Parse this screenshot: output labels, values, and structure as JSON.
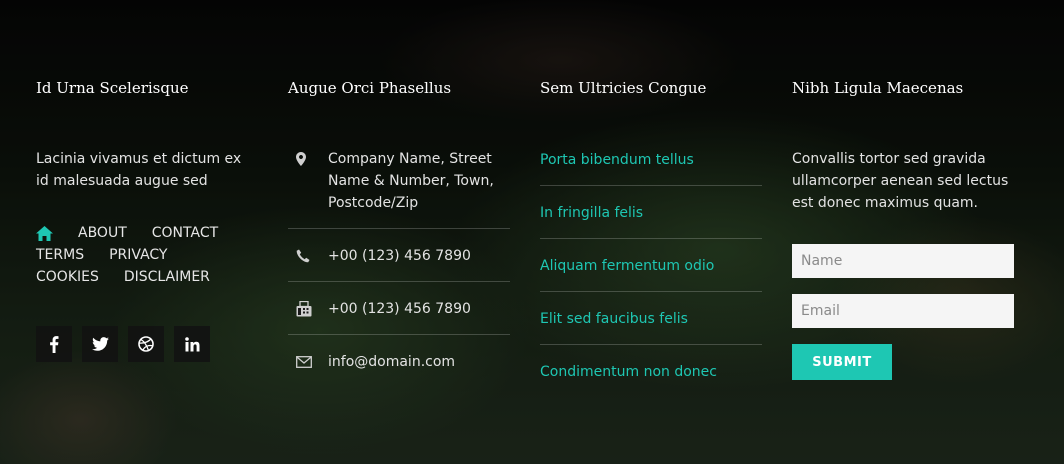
{
  "colors": {
    "accent": "#1ec7b3",
    "background": "#0b0f0b",
    "text": "#e6e6e6"
  },
  "col1": {
    "title": "Id Urna Scelerisque",
    "text": "Lacinia vivamus et dictum ex id malesuada augue sed",
    "nav": [
      "ABOUT",
      "CONTACT",
      "TERMS",
      "PRIVACY",
      "COOKIES",
      "DISCLAIMER"
    ],
    "social_icons": [
      "facebook-icon",
      "twitter-icon",
      "dribbble-icon",
      "linkedin-icon"
    ]
  },
  "col2": {
    "title": "Augue Orci Phasellus",
    "address": "Company Name, Street Name & Number, Town, Postcode/Zip",
    "phone": "+00 (123) 456 7890",
    "fax": "+00 (123) 456 7890",
    "email": "info@domain.com"
  },
  "col3": {
    "title": "Sem Ultricies Congue",
    "links": [
      "Porta bibendum tellus",
      "In fringilla felis",
      "Aliquam fermentum odio",
      "Elit sed faucibus felis",
      "Condimentum non donec"
    ]
  },
  "col4": {
    "title": "Nibh Ligula Maecenas",
    "text": "Convallis tortor sed gravida ullamcorper aenean sed lectus est donec maximus quam.",
    "name_placeholder": "Name",
    "email_placeholder": "Email",
    "submit_label": "SUBMIT"
  }
}
